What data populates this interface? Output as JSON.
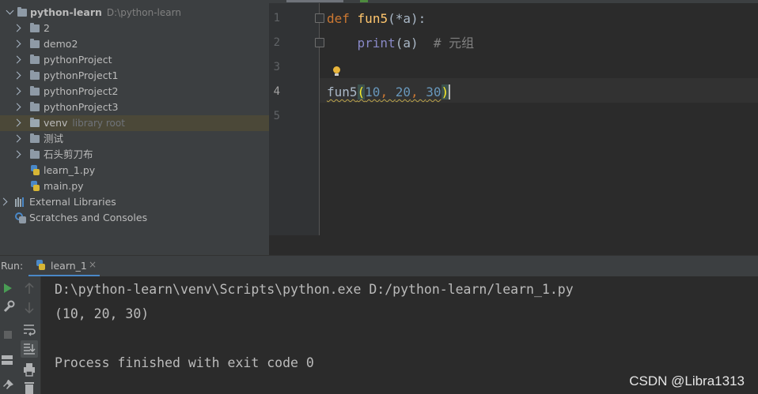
{
  "project_tree": {
    "root": {
      "label": "python-learn",
      "path": "D:\\python-learn"
    },
    "items": [
      {
        "label": "2",
        "type": "folder"
      },
      {
        "label": "demo2",
        "type": "folder"
      },
      {
        "label": "pythonProject",
        "type": "folder"
      },
      {
        "label": "pythonProject1",
        "type": "folder"
      },
      {
        "label": "pythonProject2",
        "type": "folder"
      },
      {
        "label": "pythonProject3",
        "type": "folder"
      },
      {
        "label": "venv",
        "hint": "library root",
        "type": "folder",
        "selected": true
      },
      {
        "label": "测试",
        "type": "folder"
      },
      {
        "label": "石头剪刀布",
        "type": "folder"
      },
      {
        "label": "learn_1.py",
        "type": "python-file"
      },
      {
        "label": "main.py",
        "type": "python-file"
      }
    ],
    "external_libraries": "External Libraries",
    "scratches": "Scratches and Consoles"
  },
  "editor": {
    "line_numbers": [
      "1",
      "2",
      "3",
      "4",
      "5"
    ],
    "current_line": "4",
    "code": {
      "line1": {
        "kw": "def",
        "fn": "fun5",
        "rest": "(*a):"
      },
      "line2": {
        "builtin": "print",
        "rest": "(a)",
        "comment": "# 元组"
      },
      "line4": {
        "fn": "fun5",
        "open": "(",
        "a1": "10",
        "sep1": ", ",
        "a2": "20",
        "sep2": ", ",
        "a3": "30",
        "close": ")"
      }
    }
  },
  "run_panel": {
    "title": "Run:",
    "tab_label": "learn_1",
    "tab_close": "×",
    "output": [
      "D:\\python-learn\\venv\\Scripts\\python.exe D:/python-learn/learn_1.py",
      "(10, 20, 30)",
      "",
      "Process finished with exit code 0"
    ]
  },
  "watermark": "CSDN @Libra1313",
  "colors": {
    "keyword": "#cc7832",
    "function": "#ffc66d",
    "number": "#6897bb",
    "builtin": "#8888c6",
    "comment": "#808080",
    "run_green": "#499c54"
  }
}
